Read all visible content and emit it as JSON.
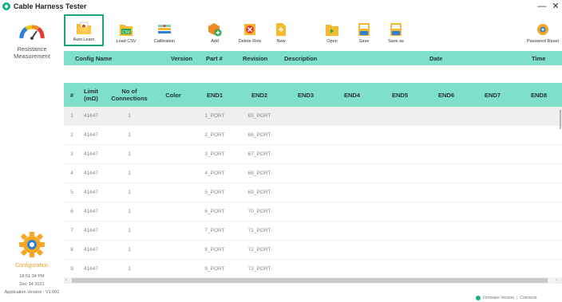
{
  "window": {
    "title": "Cable Harness Tester",
    "minimize": "—",
    "close": "✕"
  },
  "sidebar": {
    "resistance_label_line1": "Resistance",
    "resistance_label_line2": "Measurement",
    "configuration_label": "Configuration",
    "time": "18:51:34 PM",
    "date": "Dec 14 2021",
    "app_version": "Application Version : V1.001"
  },
  "toolbar": {
    "items": [
      {
        "label": "Auto Learn",
        "icon": "auto-learn-icon"
      },
      {
        "label": "Load CSV",
        "icon": "load-csv-icon"
      },
      {
        "label": "Calibration",
        "icon": "calibration-icon"
      },
      {
        "label": "Add",
        "icon": "add-icon"
      },
      {
        "label": "Delete Row",
        "icon": "delete-row-icon"
      },
      {
        "label": "New",
        "icon": "new-icon"
      },
      {
        "label": "Open",
        "icon": "open-icon"
      },
      {
        "label": "Save",
        "icon": "save-icon"
      },
      {
        "label": "Save as",
        "icon": "save-as-icon"
      },
      {
        "label": "Password Reset",
        "icon": "password-reset-icon"
      }
    ],
    "active_item": "Auto Learn"
  },
  "config_header": {
    "config_name": "Config Name",
    "version": "Version",
    "part_no": "Part #",
    "revision": "Revision",
    "description": "Description",
    "date": "Date",
    "time": "Time"
  },
  "grid": {
    "columns": {
      "index": "#",
      "limit_line1": "Limit",
      "limit_line2": "(mΩ)",
      "conn_line1": "No of",
      "conn_line2": "Connections",
      "color": "Color",
      "end1": "END1",
      "end2": "END2",
      "end3": "END3",
      "end4": "END4",
      "end5": "END5",
      "end6": "END6",
      "end7": "END7",
      "end8": "END8"
    },
    "rows": [
      {
        "n": "1",
        "limit": "41647",
        "conn": "1",
        "end1": "1_PORT",
        "end2": "65_PORT"
      },
      {
        "n": "2",
        "limit": "41647",
        "conn": "1",
        "end1": "2_PORT",
        "end2": "66_PORT"
      },
      {
        "n": "3",
        "limit": "41647",
        "conn": "1",
        "end1": "3_PORT",
        "end2": "67_PORT"
      },
      {
        "n": "4",
        "limit": "41647",
        "conn": "1",
        "end1": "4_PORT",
        "end2": "68_PORT"
      },
      {
        "n": "5",
        "limit": "41647",
        "conn": "1",
        "end1": "5_PORT",
        "end2": "69_PORT"
      },
      {
        "n": "6",
        "limit": "41647",
        "conn": "1",
        "end1": "6_PORT",
        "end2": "70_PORT"
      },
      {
        "n": "7",
        "limit": "41647",
        "conn": "1",
        "end1": "7_PORT",
        "end2": "71_PORT"
      },
      {
        "n": "8",
        "limit": "41647",
        "conn": "1",
        "end1": "8_PORT",
        "end2": "72_PORT"
      },
      {
        "n": "9",
        "limit": "41647",
        "conn": "1",
        "end1": "9_PORT",
        "end2": "73_PORT"
      }
    ],
    "selected_row": "1"
  },
  "status": {
    "firmware": "Firmware Version",
    "separator": "|",
    "connect": "Connecte"
  },
  "colors": {
    "accent": "#7fe0c9",
    "active_border": "#1aa97a",
    "brand": "#19b08a",
    "config_text": "#f0a020"
  }
}
